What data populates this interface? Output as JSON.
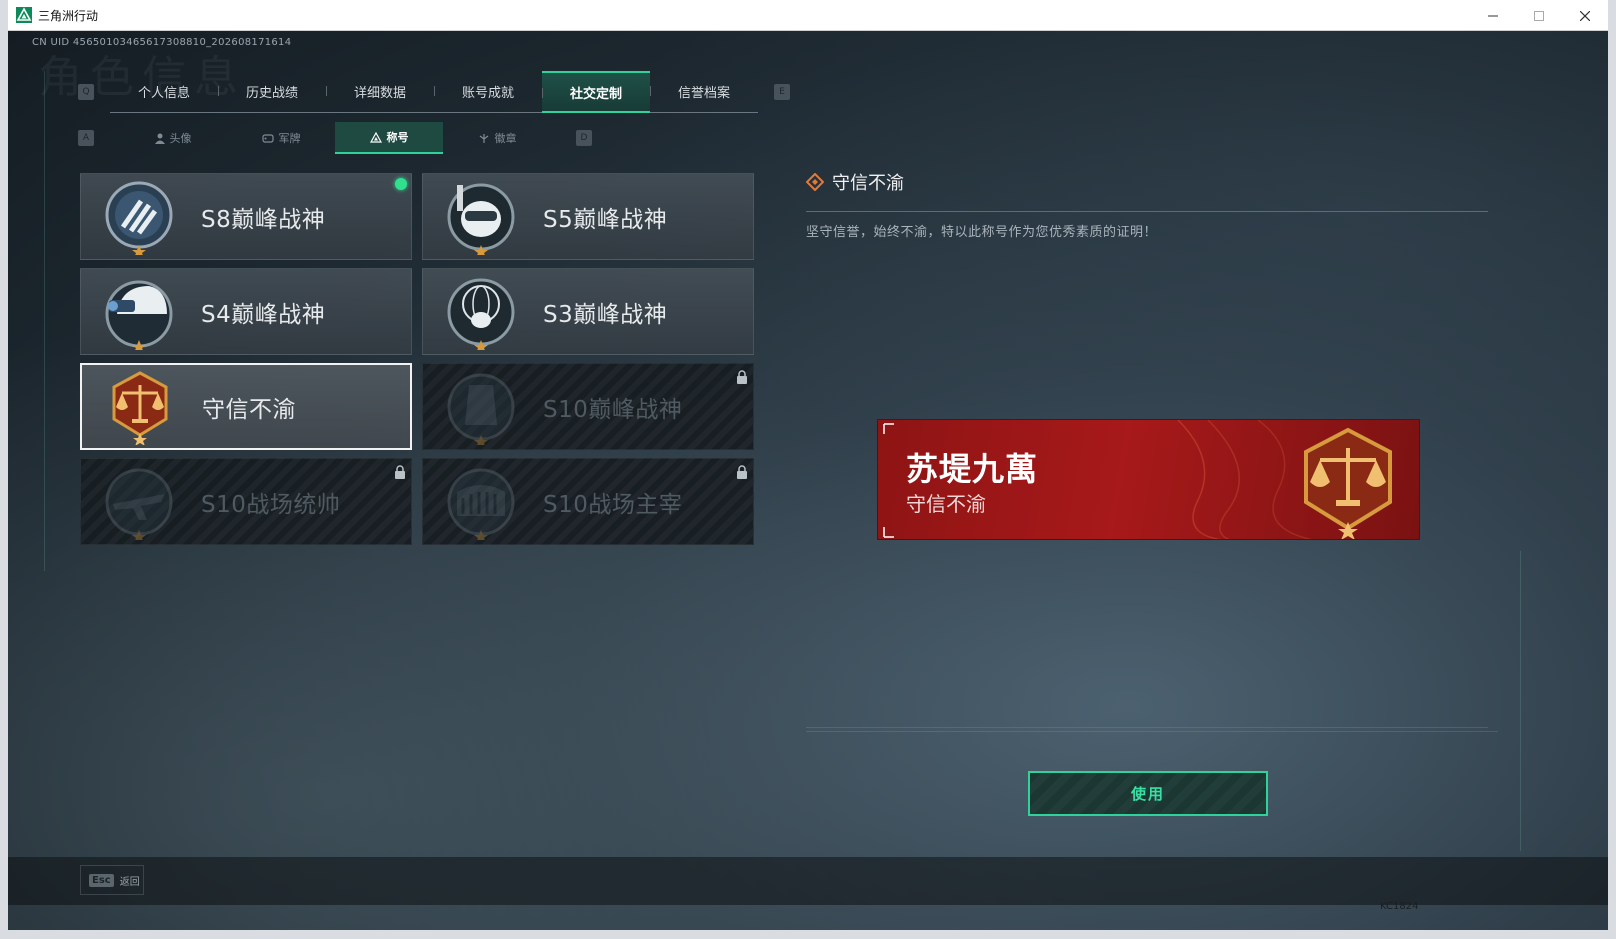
{
  "window": {
    "title": "三角洲行动",
    "controls": [
      "minimize-icon",
      "maximize-icon",
      "close-icon"
    ]
  },
  "header": {
    "uid": "CN UID 456501034656173088​10_202608171614",
    "bg_heading": "角色信息"
  },
  "main_tabs": {
    "left_key": "Q",
    "right_key": "E",
    "items": [
      {
        "label": "个人信息"
      },
      {
        "label": "历史战绩"
      },
      {
        "label": "详细数据"
      },
      {
        "label": "账号成就"
      },
      {
        "label": "社交定制",
        "active": true
      },
      {
        "label": "信誉档案"
      }
    ]
  },
  "sub_tabs": {
    "left_key": "A",
    "right_key": "D",
    "items": [
      {
        "label": "头像",
        "icon": "user-icon"
      },
      {
        "label": "军牌",
        "icon": "dogtag-icon"
      },
      {
        "label": "称号",
        "icon": "triangle-icon",
        "active": true
      },
      {
        "label": "徽章",
        "icon": "emblem-icon"
      }
    ]
  },
  "titles": [
    {
      "label": "S8巅峰战神",
      "badge": "stripes-emblem-icon",
      "equipped": true,
      "locked": false,
      "selected": false
    },
    {
      "label": "S5巅峰战神",
      "badge": "diver-skull-emblem-icon",
      "equipped": false,
      "locked": false,
      "selected": false
    },
    {
      "label": "S4巅峰战神",
      "badge": "helmet-nvg-emblem-icon",
      "equipped": false,
      "locked": false,
      "selected": false
    },
    {
      "label": "S3巅峰战神",
      "badge": "globe-skull-emblem-icon",
      "equipped": false,
      "locked": false,
      "selected": false
    },
    {
      "label": "守信不渝",
      "badge": "scales-emblem-icon",
      "equipped": false,
      "locked": false,
      "selected": true
    },
    {
      "label": "S10巅峰战神",
      "badge": "building-emblem-icon",
      "equipped": false,
      "locked": true,
      "selected": false
    },
    {
      "label": "S10战场统帅",
      "badge": "aircraft-emblem-icon",
      "equipped": false,
      "locked": true,
      "selected": false
    },
    {
      "label": "S10战场主宰",
      "badge": "colosseum-emblem-icon",
      "equipped": false,
      "locked": true,
      "selected": false
    }
  ],
  "detail": {
    "title": "守信不渝",
    "description": "坚守信誉，始终不渝，特以此称号作为您优秀素质的证明！"
  },
  "preview": {
    "player_name": "苏堤九萬",
    "title": "守信不渝"
  },
  "actions": {
    "use_label": "使用"
  },
  "footer": {
    "esc_key": "Esc",
    "esc_label": "返回",
    "code": "KC1824"
  },
  "colors": {
    "accent": "#2fd39a",
    "banner_red": "#a7191a",
    "gold": "#d79a3c"
  }
}
